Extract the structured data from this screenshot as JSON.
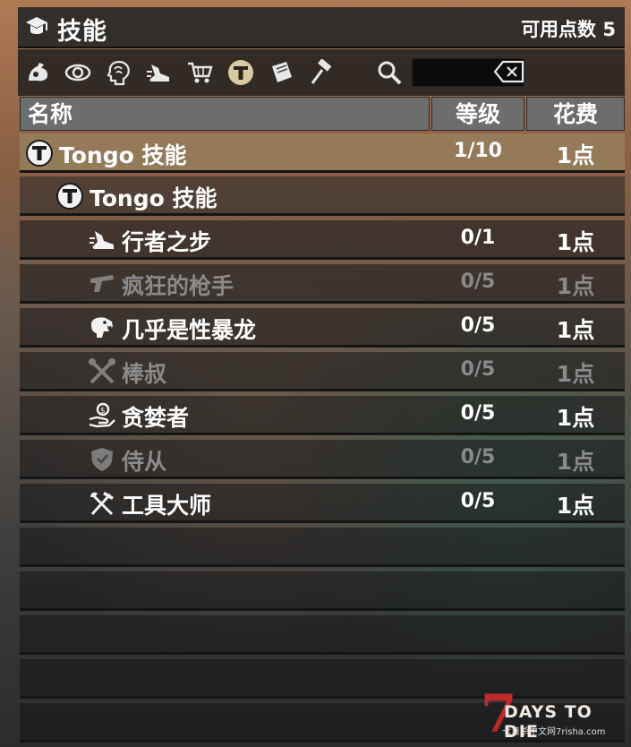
{
  "header": {
    "title": "技能",
    "points_label": "可用点数 5"
  },
  "toolbar": {
    "icons": [
      "strength-icon",
      "perception-icon",
      "intellect-icon",
      "agility-icon",
      "trade-cart-icon",
      "tongo-icon",
      "book-icon",
      "hammer-icon"
    ],
    "selected": "tongo-icon",
    "search_value": ""
  },
  "columns": {
    "name": "名称",
    "level": "等级",
    "cost": "花费"
  },
  "rows": [
    {
      "name": "Tongo 技能",
      "level": "1/10",
      "cost": "1点",
      "icon": "tongo-icon",
      "state": "selected"
    },
    {
      "name": "Tongo 技能",
      "level": "",
      "cost": "",
      "icon": "tongo-icon",
      "state": "group"
    },
    {
      "name": "行者之步",
      "level": "0/1",
      "cost": "1点",
      "icon": "running-shoe-icon",
      "state": "active"
    },
    {
      "name": "疯狂的枪手",
      "level": "0/5",
      "cost": "1点",
      "icon": "pistol-icon",
      "state": "dim"
    },
    {
      "name": "几乎是性暴龙",
      "level": "0/5",
      "cost": "1点",
      "icon": "trex-icon",
      "state": "active"
    },
    {
      "name": "棒叔",
      "level": "0/5",
      "cost": "1点",
      "icon": "crossed-clubs-icon",
      "state": "dim"
    },
    {
      "name": "贪婪者",
      "level": "0/5",
      "cost": "1点",
      "icon": "money-hand-icon",
      "state": "active"
    },
    {
      "name": "侍从",
      "level": "0/5",
      "cost": "1点",
      "icon": "shield-icon",
      "state": "dim"
    },
    {
      "name": "工具大师",
      "level": "0/5",
      "cost": "1点",
      "icon": "crossed-tools-icon",
      "state": "active"
    }
  ],
  "watermark": {
    "brand": "7DAYS TO DIE",
    "big": "7",
    "text": "DAYS TO DIE",
    "sub": "七日杀中文网7risha.com"
  },
  "colors": {
    "selected_row": "#96825f",
    "dim_text": "#8a8a8a",
    "header_cell": "#6d6d6d",
    "brand_red": "#c0282a"
  }
}
